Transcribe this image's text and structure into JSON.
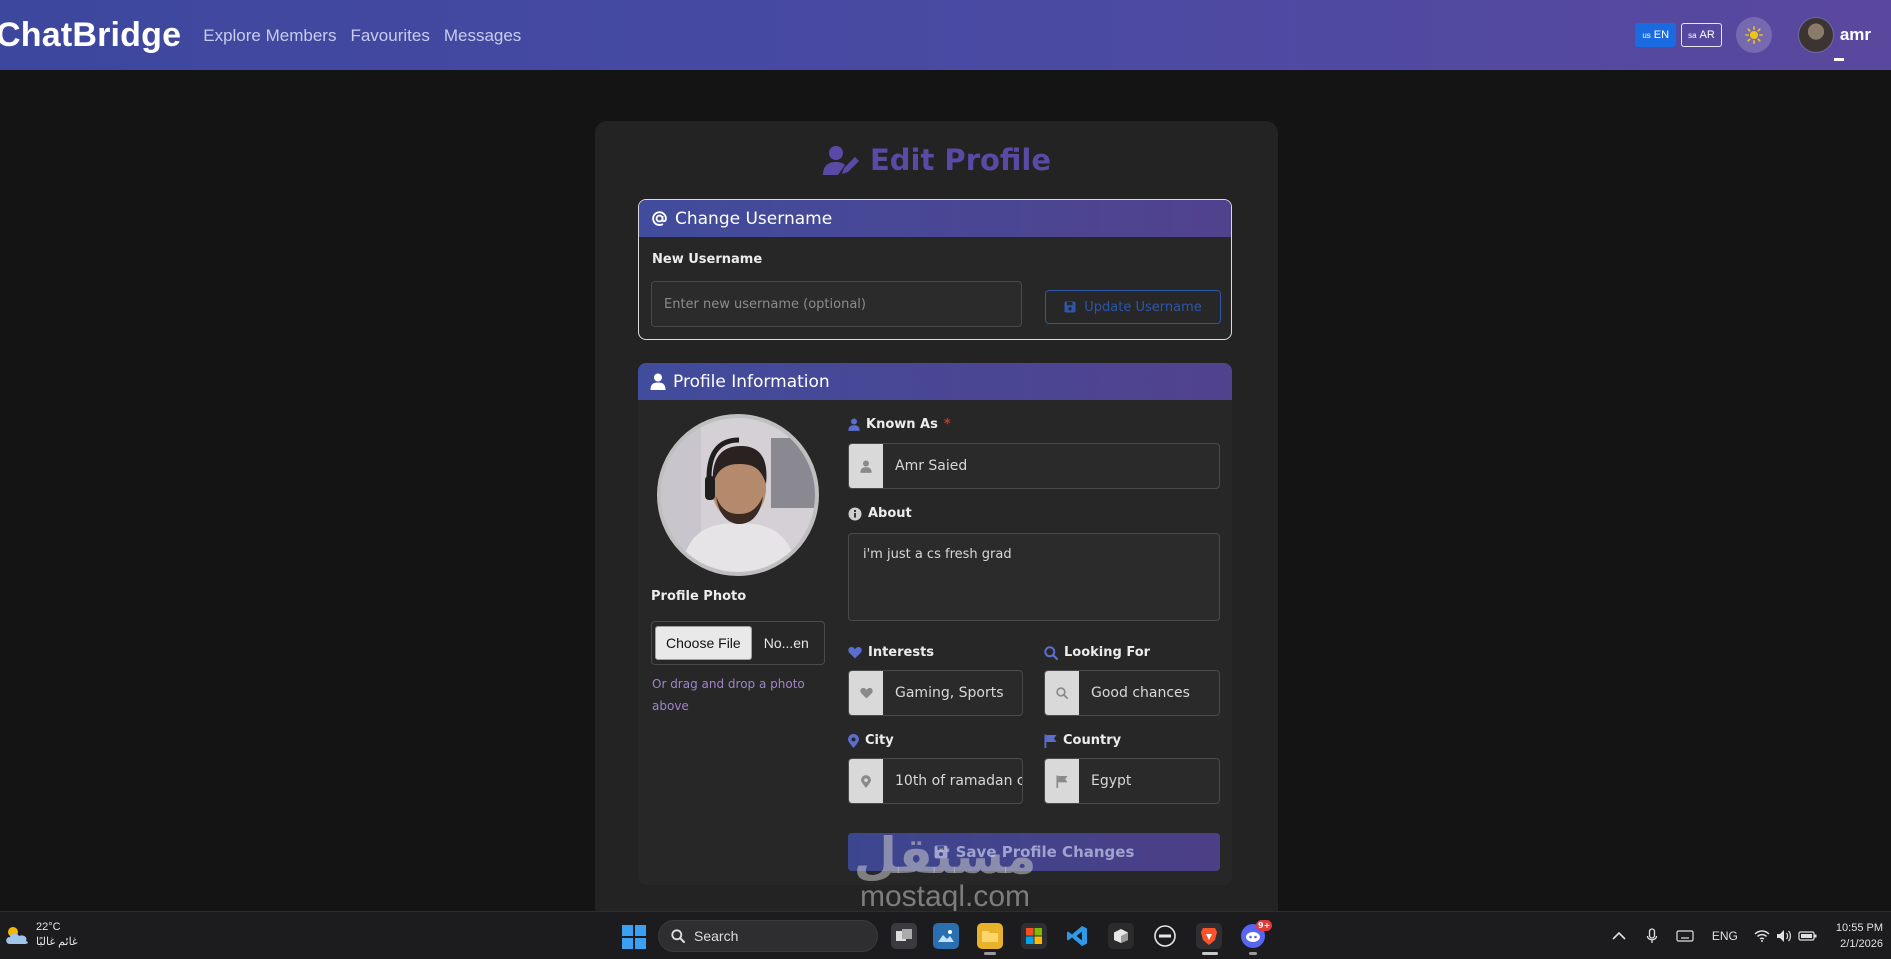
{
  "navbar": {
    "brand": "ChatBridge",
    "links": [
      "Explore Members",
      "Favourites",
      "Messages"
    ],
    "lang_en": {
      "flag": "us",
      "label": "EN"
    },
    "lang_ar": {
      "flag": "sa",
      "label": "AR"
    },
    "theme_icon": "sun-icon",
    "username": "amr"
  },
  "page": {
    "title": "Edit Profile",
    "title_icon": "user-edit-icon"
  },
  "username_section": {
    "header": "Change Username",
    "header_icon": "at-icon",
    "field_label": "New Username",
    "placeholder": "Enter new username (optional)",
    "button": "Update Username",
    "button_icon": "save-icon"
  },
  "profile_section": {
    "header": "Profile Information",
    "header_icon": "user-icon",
    "photo_label": "Profile Photo",
    "choose_file": "Choose File",
    "file_name": "No...en",
    "drop_hint": "Or drag and drop a photo above",
    "known_as": {
      "label": "Known As",
      "required_mark": "*",
      "value": "Amr Saied"
    },
    "about": {
      "label": "About",
      "value": "i'm just a cs fresh grad"
    },
    "interests": {
      "label": "Interests",
      "value": "Gaming, Sports"
    },
    "looking_for": {
      "label": "Looking For",
      "value": "Good chances"
    },
    "city": {
      "label": "City",
      "value": "10th of ramadan c"
    },
    "country": {
      "label": "Country",
      "value": "Egypt"
    },
    "save_button": "Save Profile Changes"
  },
  "watermark": {
    "arabic": "مستقل",
    "latin": "mostaql.com"
  },
  "taskbar": {
    "weather_temp": "22°C",
    "weather_desc": "غائم غالبًا",
    "search_label": "Search",
    "language": "ENG",
    "time": "10:55 PM",
    "date": "2/1/2026",
    "discord_badge": "9+"
  },
  "colors": {
    "nav_gradient_start": "#3d479e",
    "nav_gradient_end": "#5a489e",
    "title_purple": "#5b4aa5",
    "accent_blue": "#4c63c9",
    "background": "#141414",
    "card": "#232323"
  }
}
